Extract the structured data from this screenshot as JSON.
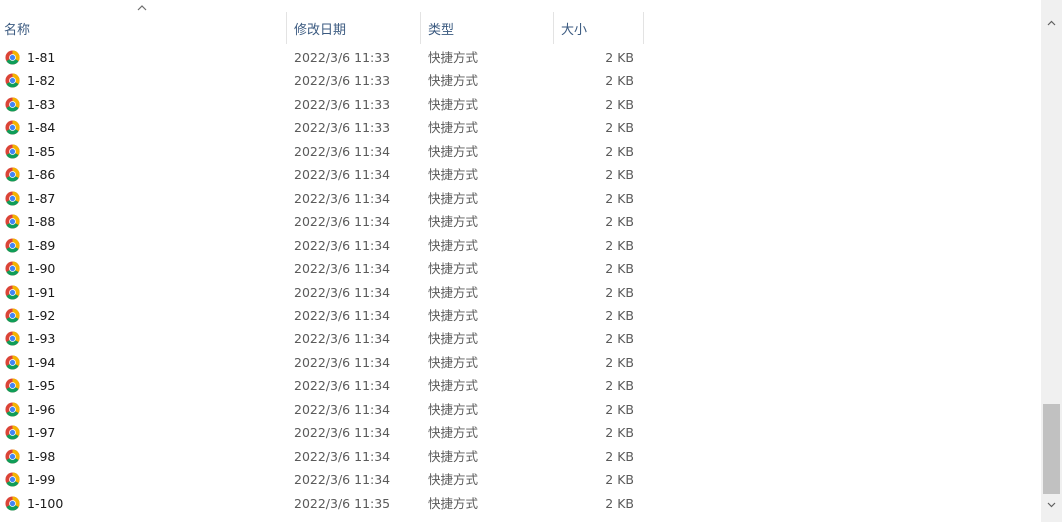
{
  "columns": {
    "name": "名称",
    "date": "修改日期",
    "type": "类型",
    "size": "大小"
  },
  "sort_indicator": "chevron-up-icon",
  "files": [
    {
      "name": "1-81",
      "date": "2022/3/6 11:33",
      "type": "快捷方式",
      "size": "2 KB"
    },
    {
      "name": "1-82",
      "date": "2022/3/6 11:33",
      "type": "快捷方式",
      "size": "2 KB"
    },
    {
      "name": "1-83",
      "date": "2022/3/6 11:33",
      "type": "快捷方式",
      "size": "2 KB"
    },
    {
      "name": "1-84",
      "date": "2022/3/6 11:33",
      "type": "快捷方式",
      "size": "2 KB"
    },
    {
      "name": "1-85",
      "date": "2022/3/6 11:34",
      "type": "快捷方式",
      "size": "2 KB"
    },
    {
      "name": "1-86",
      "date": "2022/3/6 11:34",
      "type": "快捷方式",
      "size": "2 KB"
    },
    {
      "name": "1-87",
      "date": "2022/3/6 11:34",
      "type": "快捷方式",
      "size": "2 KB"
    },
    {
      "name": "1-88",
      "date": "2022/3/6 11:34",
      "type": "快捷方式",
      "size": "2 KB"
    },
    {
      "name": "1-89",
      "date": "2022/3/6 11:34",
      "type": "快捷方式",
      "size": "2 KB"
    },
    {
      "name": "1-90",
      "date": "2022/3/6 11:34",
      "type": "快捷方式",
      "size": "2 KB"
    },
    {
      "name": "1-91",
      "date": "2022/3/6 11:34",
      "type": "快捷方式",
      "size": "2 KB"
    },
    {
      "name": "1-92",
      "date": "2022/3/6 11:34",
      "type": "快捷方式",
      "size": "2 KB"
    },
    {
      "name": "1-93",
      "date": "2022/3/6 11:34",
      "type": "快捷方式",
      "size": "2 KB"
    },
    {
      "name": "1-94",
      "date": "2022/3/6 11:34",
      "type": "快捷方式",
      "size": "2 KB"
    },
    {
      "name": "1-95",
      "date": "2022/3/6 11:34",
      "type": "快捷方式",
      "size": "2 KB"
    },
    {
      "name": "1-96",
      "date": "2022/3/6 11:34",
      "type": "快捷方式",
      "size": "2 KB"
    },
    {
      "name": "1-97",
      "date": "2022/3/6 11:34",
      "type": "快捷方式",
      "size": "2 KB"
    },
    {
      "name": "1-98",
      "date": "2022/3/6 11:34",
      "type": "快捷方式",
      "size": "2 KB"
    },
    {
      "name": "1-99",
      "date": "2022/3/6 11:34",
      "type": "快捷方式",
      "size": "2 KB"
    },
    {
      "name": "1-100",
      "date": "2022/3/6 11:35",
      "type": "快捷方式",
      "size": "2 KB"
    }
  ],
  "file_icon": "chrome-icon"
}
